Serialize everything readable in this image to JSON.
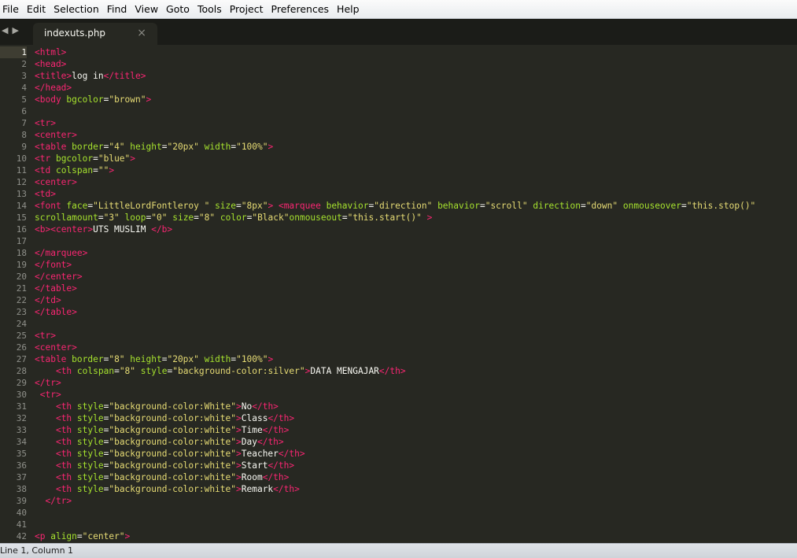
{
  "menu": [
    "File",
    "Edit",
    "Selection",
    "Find",
    "View",
    "Goto",
    "Tools",
    "Project",
    "Preferences",
    "Help"
  ],
  "tab": {
    "filename": "indexuts.php",
    "close_glyph": "×"
  },
  "nav": {
    "back_glyph": "◀",
    "forward_glyph": "▶"
  },
  "active_line": 1,
  "status": "Line 1, Column 1",
  "lines": [
    [
      [
        "t",
        "<html>"
      ]
    ],
    [
      [
        "t",
        "<head>"
      ]
    ],
    [
      [
        "t",
        "<title>"
      ],
      [
        "p",
        "log in"
      ],
      [
        "t",
        "</title>"
      ]
    ],
    [
      [
        "t",
        "</head>"
      ]
    ],
    [
      [
        "t",
        "<body "
      ],
      [
        "a",
        "bgcolor"
      ],
      [
        "p",
        "="
      ],
      [
        "s",
        "\"brown\""
      ],
      [
        "t",
        ">"
      ]
    ],
    [],
    [
      [
        "t",
        "<tr>"
      ]
    ],
    [
      [
        "t",
        "<center>"
      ]
    ],
    [
      [
        "t",
        "<table "
      ],
      [
        "a",
        "border"
      ],
      [
        "p",
        "="
      ],
      [
        "s",
        "\"4\""
      ],
      [
        "p",
        " "
      ],
      [
        "a",
        "height"
      ],
      [
        "p",
        "="
      ],
      [
        "s",
        "\"20px\""
      ],
      [
        "p",
        " "
      ],
      [
        "a",
        "width"
      ],
      [
        "p",
        "="
      ],
      [
        "s",
        "\"100%\""
      ],
      [
        "t",
        ">"
      ]
    ],
    [
      [
        "t",
        "<tr "
      ],
      [
        "a",
        "bgcolor"
      ],
      [
        "p",
        "="
      ],
      [
        "s",
        "\"blue\""
      ],
      [
        "t",
        ">"
      ]
    ],
    [
      [
        "t",
        "<td "
      ],
      [
        "a",
        "colspan"
      ],
      [
        "p",
        "="
      ],
      [
        "s",
        "\"\""
      ],
      [
        "t",
        ">"
      ]
    ],
    [
      [
        "t",
        "<center>"
      ]
    ],
    [
      [
        "t",
        "<td>"
      ]
    ],
    [
      [
        "t",
        "<font "
      ],
      [
        "a",
        "face"
      ],
      [
        "p",
        "="
      ],
      [
        "s",
        "\"LittleLordFontleroy \""
      ],
      [
        "p",
        " "
      ],
      [
        "a",
        "size"
      ],
      [
        "p",
        "="
      ],
      [
        "s",
        "\"8px\""
      ],
      [
        "t",
        ">"
      ],
      [
        "p",
        " "
      ],
      [
        "t",
        "<marquee "
      ],
      [
        "a",
        "behavior"
      ],
      [
        "p",
        "="
      ],
      [
        "s",
        "\"direction\""
      ],
      [
        "p",
        " "
      ],
      [
        "a",
        "behavior"
      ],
      [
        "p",
        "="
      ],
      [
        "s",
        "\"scroll\""
      ],
      [
        "p",
        " "
      ],
      [
        "a",
        "direction"
      ],
      [
        "p",
        "="
      ],
      [
        "s",
        "\"down\""
      ],
      [
        "p",
        " "
      ],
      [
        "a",
        "onmouseover"
      ],
      [
        "p",
        "="
      ],
      [
        "s",
        "\"this.stop()\""
      ]
    ],
    [
      [
        "a",
        "scrollamount"
      ],
      [
        "p",
        "="
      ],
      [
        "s",
        "\"3\""
      ],
      [
        "p",
        " "
      ],
      [
        "a",
        "loop"
      ],
      [
        "p",
        "="
      ],
      [
        "s",
        "\"0\""
      ],
      [
        "p",
        " "
      ],
      [
        "a",
        "size"
      ],
      [
        "p",
        "="
      ],
      [
        "s",
        "\"8\""
      ],
      [
        "p",
        " "
      ],
      [
        "a",
        "color"
      ],
      [
        "p",
        "="
      ],
      [
        "s",
        "\"Black\""
      ],
      [
        "a",
        "onmouseout"
      ],
      [
        "p",
        "="
      ],
      [
        "s",
        "\"this.start()\""
      ],
      [
        "p",
        " "
      ],
      [
        "t",
        ">"
      ]
    ],
    [
      [
        "t",
        "<b>"
      ],
      [
        "t",
        "<center>"
      ],
      [
        "p",
        "UTS MUSLIM "
      ],
      [
        "t",
        "</b>"
      ]
    ],
    [],
    [
      [
        "t",
        "</marquee>"
      ]
    ],
    [
      [
        "t",
        "</font>"
      ]
    ],
    [
      [
        "t",
        "</center>"
      ]
    ],
    [
      [
        "t",
        "</table>"
      ]
    ],
    [
      [
        "t",
        "</td>"
      ]
    ],
    [
      [
        "t",
        "</table>"
      ]
    ],
    [],
    [
      [
        "t",
        "<tr>"
      ]
    ],
    [
      [
        "t",
        "<center>"
      ]
    ],
    [
      [
        "t",
        "<table "
      ],
      [
        "a",
        "border"
      ],
      [
        "p",
        "="
      ],
      [
        "s",
        "\"8\""
      ],
      [
        "p",
        " "
      ],
      [
        "a",
        "height"
      ],
      [
        "p",
        "="
      ],
      [
        "s",
        "\"20px\""
      ],
      [
        "p",
        " "
      ],
      [
        "a",
        "width"
      ],
      [
        "p",
        "="
      ],
      [
        "s",
        "\"100%\""
      ],
      [
        "t",
        ">"
      ]
    ],
    [
      [
        "p",
        "    "
      ],
      [
        "t",
        "<th "
      ],
      [
        "a",
        "colspan"
      ],
      [
        "p",
        "="
      ],
      [
        "s",
        "\"8\""
      ],
      [
        "p",
        " "
      ],
      [
        "a",
        "style"
      ],
      [
        "p",
        "="
      ],
      [
        "s",
        "\"background-color:silver\""
      ],
      [
        "t",
        ">"
      ],
      [
        "p",
        "DATA MENGAJAR"
      ],
      [
        "t",
        "</th>"
      ]
    ],
    [
      [
        "t",
        "</tr>"
      ]
    ],
    [
      [
        "p",
        " "
      ],
      [
        "t",
        "<tr>"
      ]
    ],
    [
      [
        "p",
        "    "
      ],
      [
        "t",
        "<th "
      ],
      [
        "a",
        "style"
      ],
      [
        "p",
        "="
      ],
      [
        "s",
        "\"background-color:White\""
      ],
      [
        "t",
        ">"
      ],
      [
        "p",
        "No"
      ],
      [
        "t",
        "</th>"
      ]
    ],
    [
      [
        "p",
        "    "
      ],
      [
        "t",
        "<th "
      ],
      [
        "a",
        "style"
      ],
      [
        "p",
        "="
      ],
      [
        "s",
        "\"background-color:white\""
      ],
      [
        "t",
        ">"
      ],
      [
        "p",
        "Class"
      ],
      [
        "t",
        "</th>"
      ]
    ],
    [
      [
        "p",
        "    "
      ],
      [
        "t",
        "<th "
      ],
      [
        "a",
        "style"
      ],
      [
        "p",
        "="
      ],
      [
        "s",
        "\"background-color:white\""
      ],
      [
        "t",
        ">"
      ],
      [
        "p",
        "Time"
      ],
      [
        "t",
        "</th>"
      ]
    ],
    [
      [
        "p",
        "    "
      ],
      [
        "t",
        "<th "
      ],
      [
        "a",
        "style"
      ],
      [
        "p",
        "="
      ],
      [
        "s",
        "\"background-color:white\""
      ],
      [
        "t",
        ">"
      ],
      [
        "p",
        "Day"
      ],
      [
        "t",
        "</th>"
      ]
    ],
    [
      [
        "p",
        "    "
      ],
      [
        "t",
        "<th "
      ],
      [
        "a",
        "style"
      ],
      [
        "p",
        "="
      ],
      [
        "s",
        "\"background-color:white\""
      ],
      [
        "t",
        ">"
      ],
      [
        "p",
        "Teacher"
      ],
      [
        "t",
        "</th>"
      ]
    ],
    [
      [
        "p",
        "    "
      ],
      [
        "t",
        "<th "
      ],
      [
        "a",
        "style"
      ],
      [
        "p",
        "="
      ],
      [
        "s",
        "\"background-color:white\""
      ],
      [
        "t",
        ">"
      ],
      [
        "p",
        "Start"
      ],
      [
        "t",
        "</th>"
      ]
    ],
    [
      [
        "p",
        "    "
      ],
      [
        "t",
        "<th "
      ],
      [
        "a",
        "style"
      ],
      [
        "p",
        "="
      ],
      [
        "s",
        "\"background-color:white\""
      ],
      [
        "t",
        ">"
      ],
      [
        "p",
        "Room"
      ],
      [
        "t",
        "</th>"
      ]
    ],
    [
      [
        "p",
        "    "
      ],
      [
        "t",
        "<th "
      ],
      [
        "a",
        "style"
      ],
      [
        "p",
        "="
      ],
      [
        "s",
        "\"background-color:white\""
      ],
      [
        "t",
        ">"
      ],
      [
        "p",
        "Remark"
      ],
      [
        "t",
        "</th>"
      ]
    ],
    [
      [
        "p",
        "  "
      ],
      [
        "t",
        "</tr>"
      ]
    ],
    [],
    [],
    [
      [
        "t",
        "<p "
      ],
      [
        "a",
        "align"
      ],
      [
        "p",
        "="
      ],
      [
        "s",
        "\"center\""
      ],
      [
        "t",
        ">"
      ]
    ]
  ]
}
